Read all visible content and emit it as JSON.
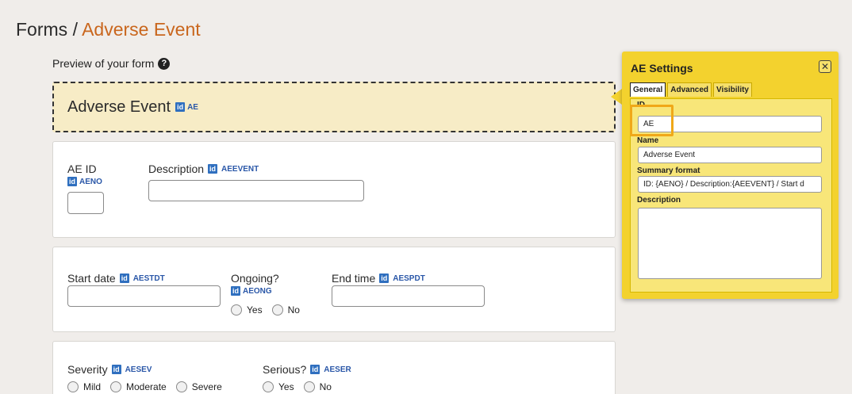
{
  "breadcrumb": {
    "root": "Forms",
    "separator": "/",
    "current": "Adverse Event"
  },
  "preview": {
    "label": "Preview of your form",
    "help_icon": "question-circle-icon"
  },
  "form_header": {
    "title": "Adverse Event",
    "badge": "id",
    "code": "AE"
  },
  "cards": {
    "card1": {
      "ae_id": {
        "label": "AE ID",
        "badge": "id",
        "code": "AENO",
        "value": ""
      },
      "description": {
        "label": "Description",
        "badge": "id",
        "code": "AEEVENT",
        "value": ""
      }
    },
    "card2": {
      "start_date": {
        "label": "Start date",
        "badge": "id",
        "code": "AESTDT",
        "value": ""
      },
      "ongoing": {
        "label": "Ongoing?",
        "badge": "id",
        "code": "AEONG",
        "options": [
          "Yes",
          "No"
        ]
      },
      "end_time": {
        "label": "End time",
        "badge": "id",
        "code": "AESPDT",
        "value": ""
      }
    },
    "card3": {
      "severity": {
        "label": "Severity",
        "badge": "id",
        "code": "AESEV",
        "options": [
          "Mild",
          "Moderate",
          "Severe"
        ]
      },
      "serious": {
        "label": "Serious?",
        "badge": "id",
        "code": "AESER",
        "options": [
          "Yes",
          "No"
        ]
      }
    }
  },
  "settings": {
    "title": "AE Settings",
    "close_icon": "close-icon",
    "tabs": [
      "General",
      "Advanced",
      "Visibility"
    ],
    "active_tab": "General",
    "id_label": "ID",
    "id_value": "AE",
    "name_label": "Name",
    "name_value": "Adverse Event",
    "summary_label": "Summary format",
    "summary_value": "ID: {AENO} / Description:{AEEVENT} / Start d",
    "description_label": "Description",
    "description_value": ""
  },
  "colors": {
    "accent": "#c9661d",
    "panel": "#f3d22e",
    "badge": "#2f6fbf",
    "highlight": "#f0a818"
  }
}
